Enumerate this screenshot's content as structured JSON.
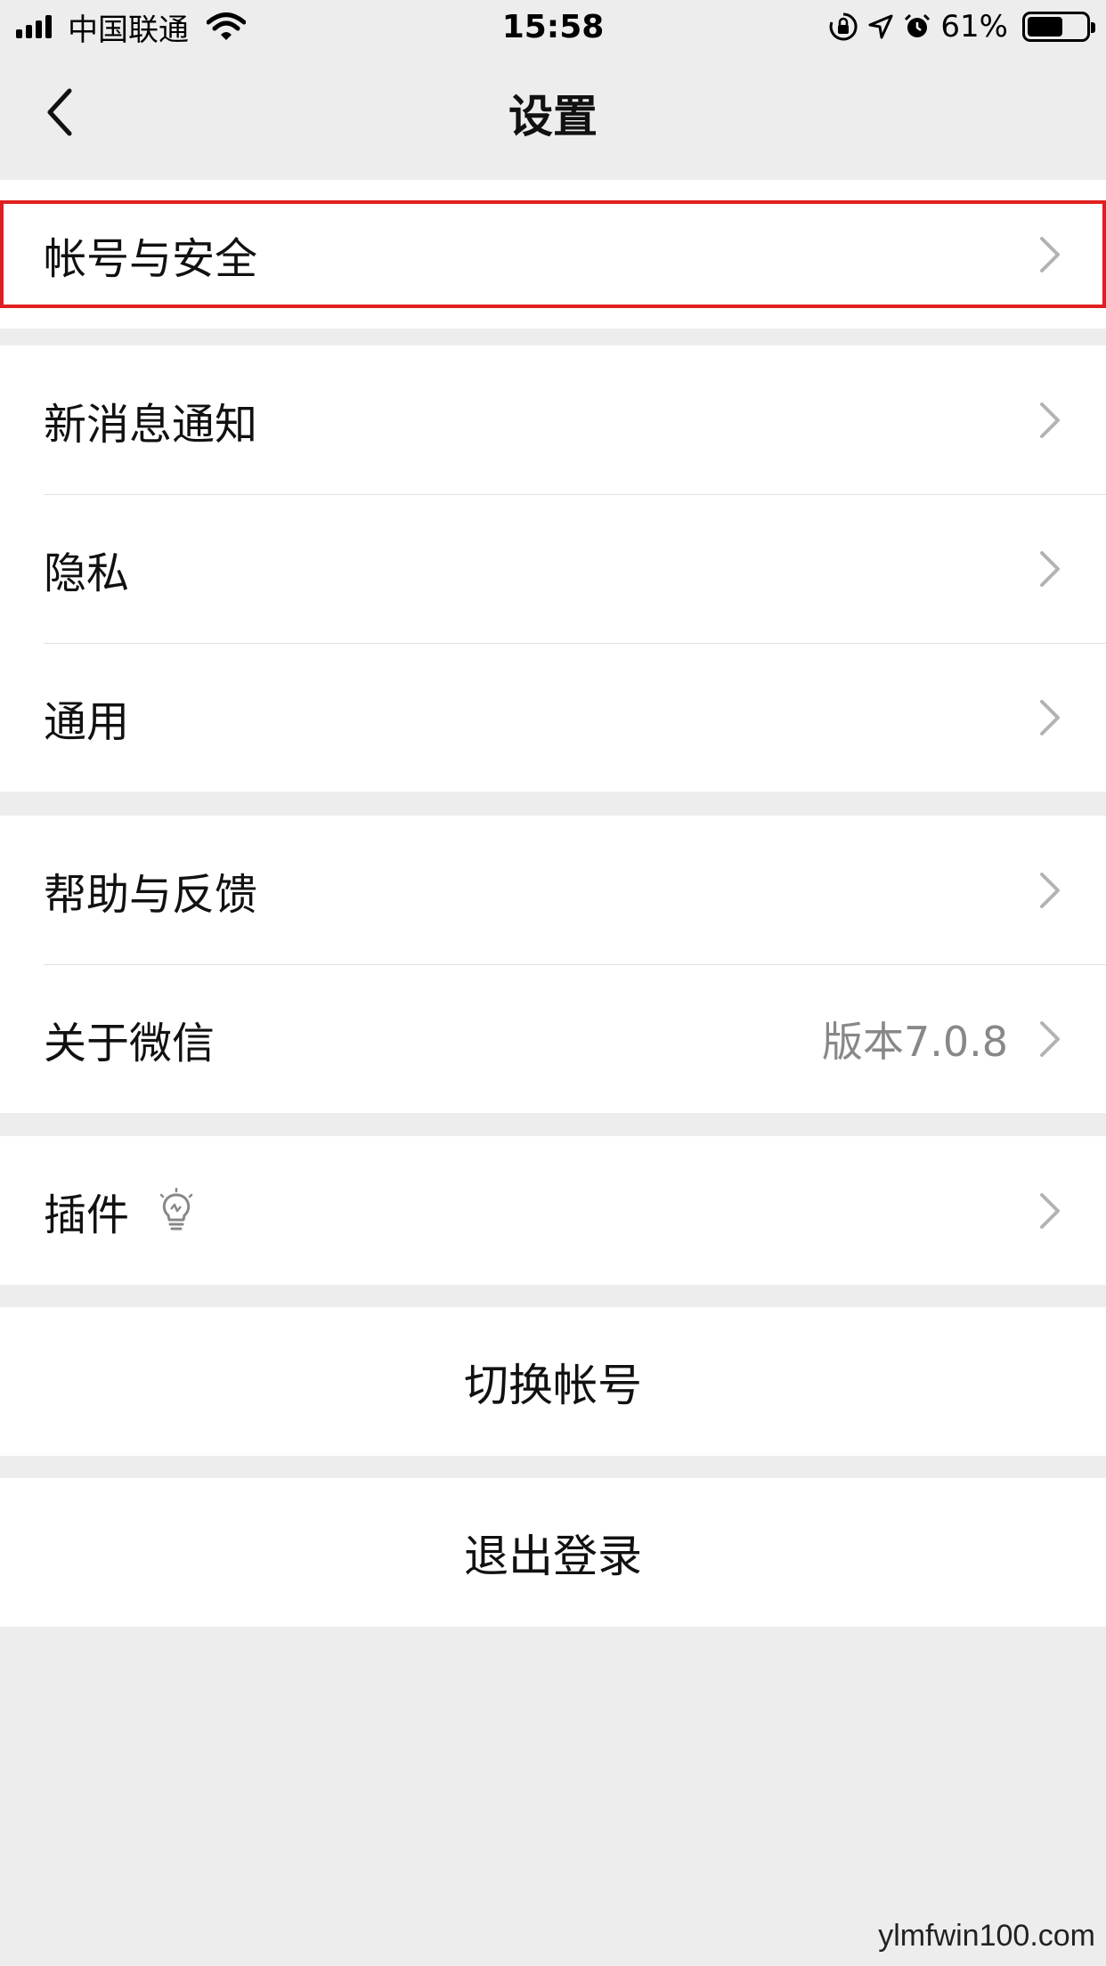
{
  "status_bar": {
    "carrier": "中国联通",
    "time": "15:58",
    "battery_percent": "61%",
    "battery_level": 0.61,
    "icons": [
      "signal-icon",
      "wifi-icon",
      "rotation-lock-icon",
      "location-icon",
      "alarm-icon",
      "battery-icon"
    ]
  },
  "nav": {
    "title": "设置",
    "back_icon": "chevron-left-icon"
  },
  "groups": {
    "account": [
      {
        "label": "帐号与安全"
      }
    ],
    "main": [
      {
        "label": "新消息通知"
      },
      {
        "label": "隐私"
      },
      {
        "label": "通用"
      }
    ],
    "about": [
      {
        "label": "帮助与反馈"
      },
      {
        "label": "关于微信",
        "value": "版本7.0.8"
      }
    ],
    "plugins": [
      {
        "label": "插件",
        "icon": "lightbulb-icon"
      }
    ]
  },
  "actions": {
    "switch_account": "切换帐号",
    "logout": "退出登录"
  },
  "highlight_color": "#e02020",
  "watermark": "ylmfwin100.com"
}
